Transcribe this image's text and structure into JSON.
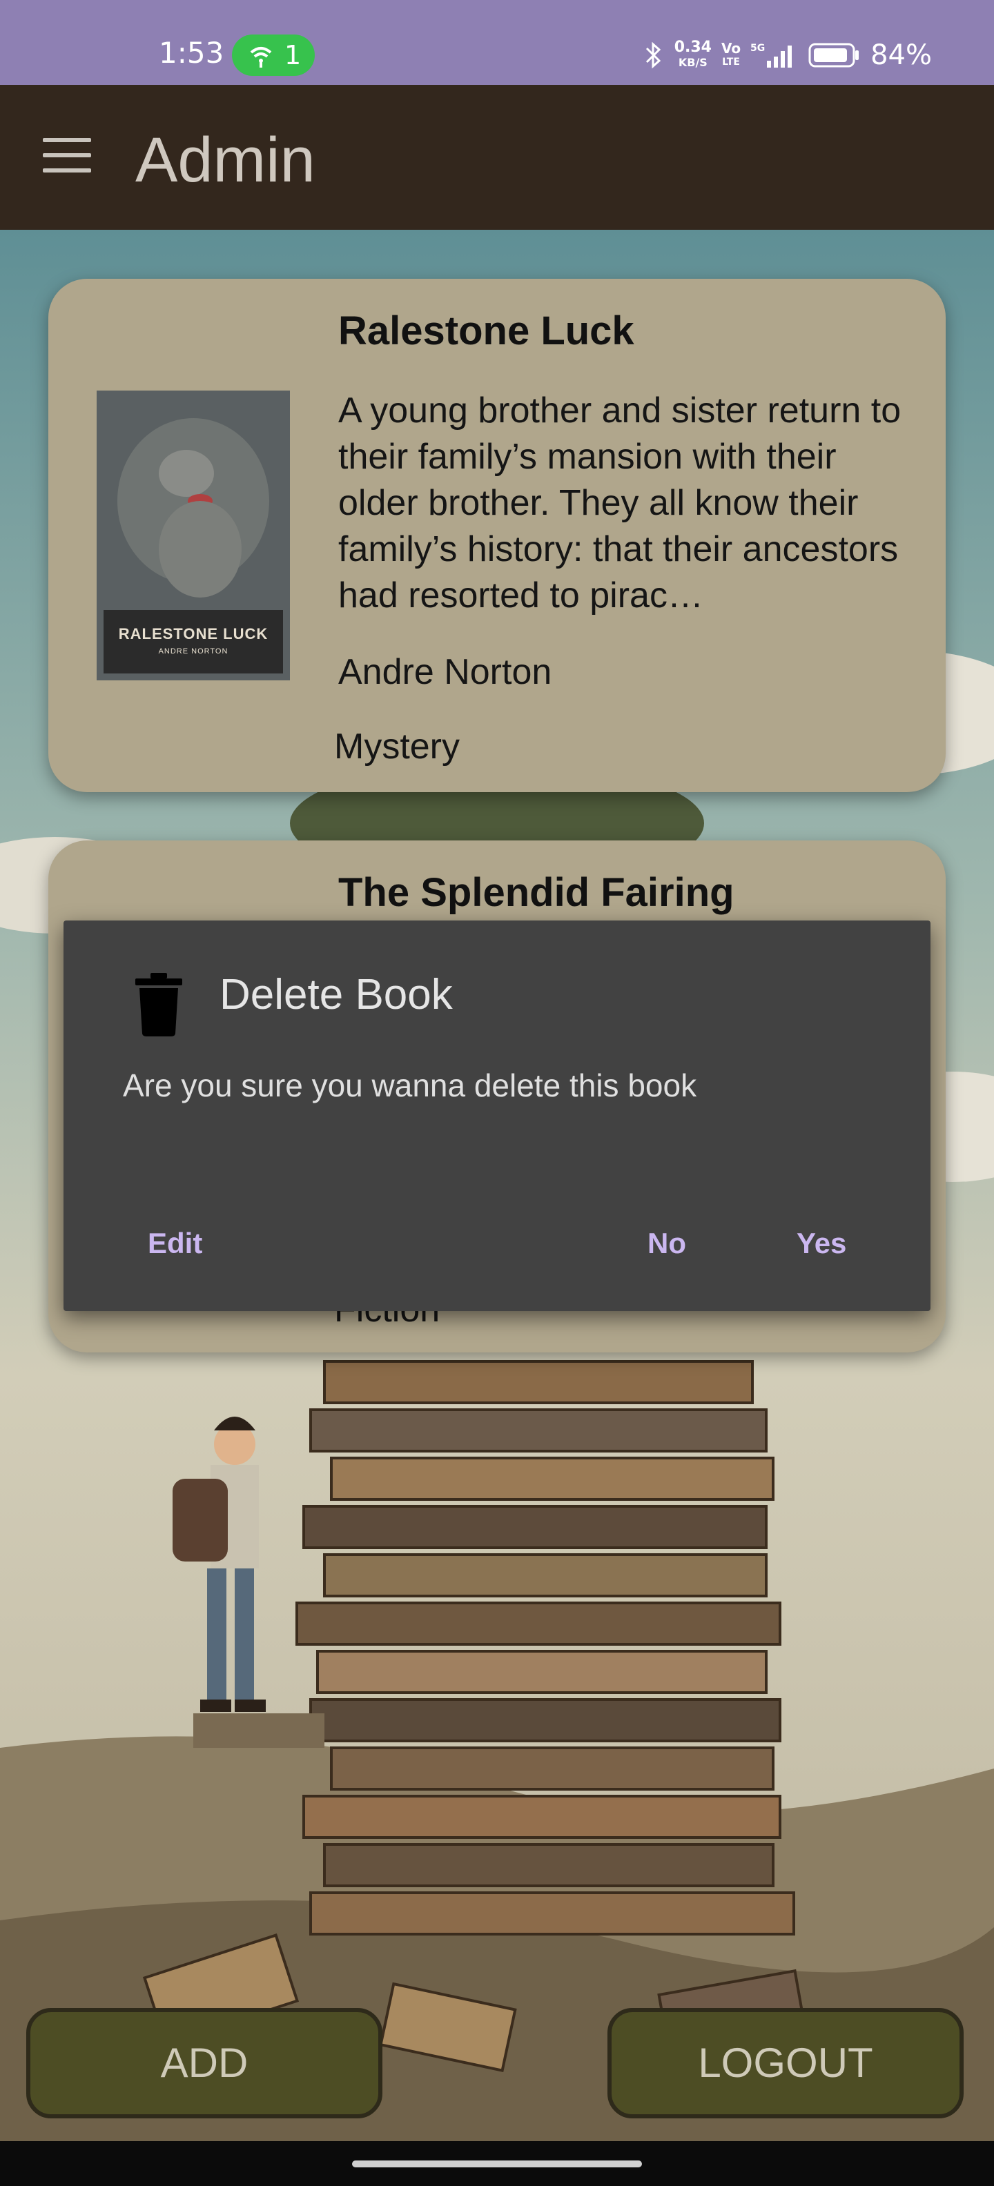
{
  "status_bar": {
    "time": "1:53",
    "hotspot_count": "1",
    "speed_value": "0.34",
    "speed_unit": "KB/S",
    "volte_top": "Vo",
    "volte_bottom": "LTE",
    "network": "5G",
    "battery": "84%",
    "icons": [
      "hotspot-icon",
      "bluetooth-icon",
      "signal-icon",
      "battery-icon"
    ]
  },
  "app_bar": {
    "title": "Admin",
    "menu_icon": "hamburger-menu-icon"
  },
  "books": [
    {
      "title": "Ralestone Luck",
      "description": "A young brother and sister return to their family’s mansion with their older brother. They all know their family’s history: that their ancestors had resorted to pirac…",
      "author": "Andre Norton",
      "genre": "Mystery",
      "cover_title": "RALESTONE LUCK",
      "cover_author": "ANDRE NORTON"
    },
    {
      "title": "The Splendid Fairing",
      "genre": "Fiction"
    }
  ],
  "dialog": {
    "title": "Delete Book",
    "icon": "trash-icon",
    "message": "Are you sure you wanna delete this book",
    "edit_label": "Edit",
    "no_label": "No",
    "yes_label": "Yes"
  },
  "bottom": {
    "add_label": "ADD",
    "logout_label": "LOGOUT"
  },
  "colors": {
    "status_bar": "#8e80b3",
    "app_bar": "#33271d",
    "card": "#b0a68c",
    "dialog": "#424242",
    "dialog_button_text": "#cbb7f0",
    "bottom_button": "#4d4d24"
  }
}
